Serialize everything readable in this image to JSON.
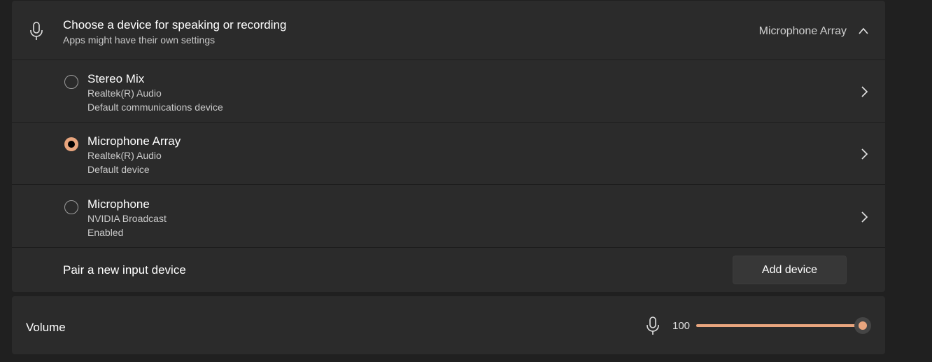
{
  "header": {
    "icon": "microphone-icon",
    "title": "Choose a device for speaking or recording",
    "subtitle": "Apps might have their own settings",
    "selected_device": "Microphone Array",
    "expand_icon": "chevron-up-icon"
  },
  "devices": [
    {
      "name": "Stereo Mix",
      "driver": "Realtek(R) Audio",
      "status": "Default communications device",
      "selected": false
    },
    {
      "name": "Microphone Array",
      "driver": "Realtek(R) Audio",
      "status": "Default device",
      "selected": true
    },
    {
      "name": "Microphone",
      "driver": "NVIDIA Broadcast",
      "status": "Enabled",
      "selected": false
    }
  ],
  "pair": {
    "label": "Pair a new input device",
    "button_label": "Add device"
  },
  "volume": {
    "label": "Volume",
    "icon": "microphone-icon",
    "value": "100",
    "level": 100
  },
  "colors": {
    "accent": "#e8a57e",
    "panel": "#2b2b2b",
    "background": "#202020"
  }
}
